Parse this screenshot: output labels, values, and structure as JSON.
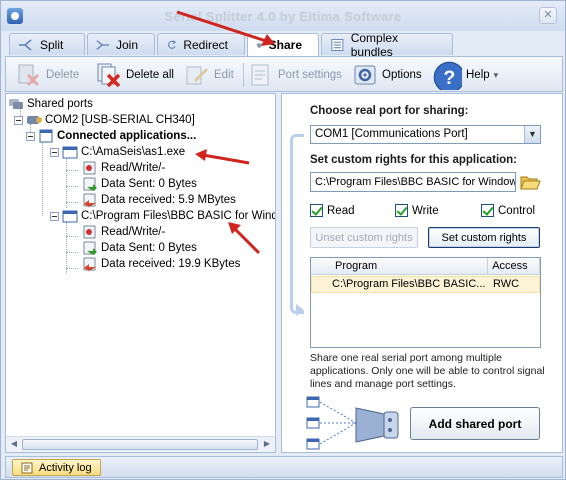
{
  "window": {
    "title": "Serial Splitter 4.0 by Eltima Software",
    "close_glyph": "✕"
  },
  "tabs": [
    {
      "label": "Split",
      "icon": "split-icon"
    },
    {
      "label": "Join",
      "icon": "join-icon"
    },
    {
      "label": "Redirect",
      "icon": "redirect-icon"
    },
    {
      "label": "Share",
      "icon": "share-icon",
      "active": true
    },
    {
      "label": "Complex bundles",
      "icon": "complex-bundles-icon"
    }
  ],
  "toolbar": {
    "delete": "Delete",
    "delete_all": "Delete all",
    "edit": "Edit",
    "port_settings": "Port settings",
    "options": "Options",
    "help": "Help",
    "help_arrow": "▾"
  },
  "tree": {
    "root": "Shared ports",
    "port": "COM2 [USB-SERIAL CH340]",
    "connected": "Connected applications...",
    "apps": [
      {
        "name": "C:\\AmaSeis\\as1.exe",
        "rights": "Read/Write/-",
        "sent": "Data Sent: 0 Bytes",
        "received": "Data received: 5.9 MBytes"
      },
      {
        "name": "C:\\Program Files\\BBC BASIC for Windows",
        "rights": "Read/Write/-",
        "sent": "Data Sent: 0 Bytes",
        "received": "Data received: 19.9 KBytes"
      }
    ]
  },
  "right": {
    "choose_label": "Choose real port for sharing:",
    "port_value": "COM1 [Communications Port]",
    "rights_label": "Set custom rights for this application:",
    "path_value": "C:\\Program Files\\BBC BASIC for Windows",
    "read": "Read",
    "write": "Write",
    "control": "Control",
    "unset_button": "Unset custom rights",
    "set_button": "Set custom rights",
    "list_headers": {
      "program": "Program",
      "access": "Access"
    },
    "list_rows": [
      {
        "program": "C:\\Program Files\\BBC BASIC...",
        "access": "RWC"
      }
    ],
    "info": "Share one real serial port among multiple applications. Only one will be able to control signal lines and manage port settings.",
    "add_button": "Add shared port"
  },
  "status": {
    "activity_log": "Activity log"
  },
  "colors": {
    "accent": "#2f62b3",
    "arrow": "#d0241f",
    "selection": "#fdf3d6"
  }
}
